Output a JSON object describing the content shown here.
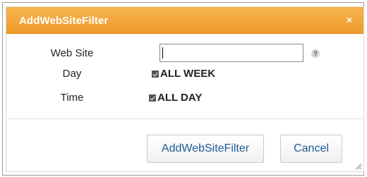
{
  "dialog": {
    "title": "AddWebSiteFilter",
    "close_glyph": "×"
  },
  "form": {
    "website": {
      "label": "Web Site",
      "value": "",
      "help_glyph": "?"
    },
    "day": {
      "label": "Day",
      "checkbox_label": "ALL WEEK",
      "checked": true
    },
    "time": {
      "label": "Time",
      "checkbox_label": "ALL DAY",
      "checked": true
    }
  },
  "buttons": {
    "add_label": "AddWebSiteFilter",
    "cancel_label": "Cancel"
  },
  "colors": {
    "titlebar": "#f0a030",
    "button_text": "#1d5d95"
  }
}
